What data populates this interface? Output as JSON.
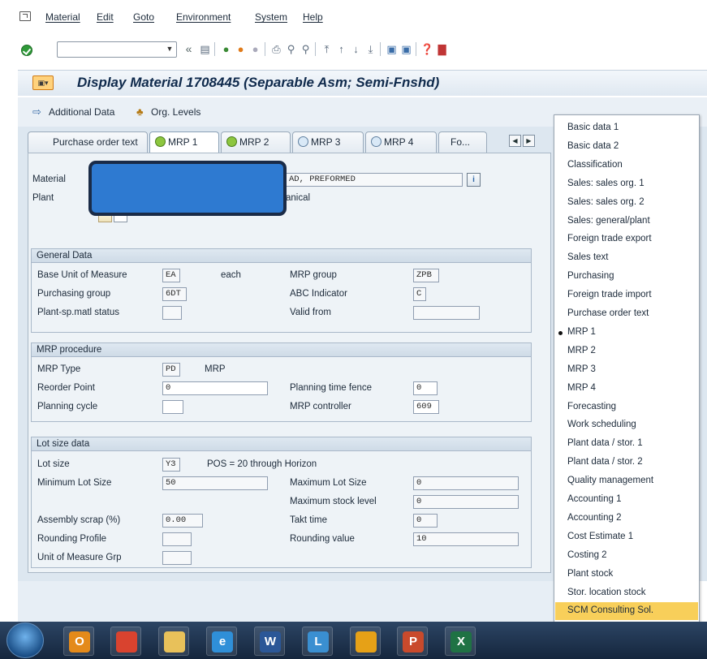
{
  "menu": [
    "Material",
    "Edit",
    "Goto",
    "Environment",
    "System",
    "Help"
  ],
  "toolbar": {
    "command_field_value": "",
    "back_glyph": "«"
  },
  "title": "Display Material 1708445 (Separable Asm; Semi-Fnshd)",
  "app_toolbar": {
    "additional_data": "Additional Data",
    "org_levels": "Org. Levels"
  },
  "tabs": [
    {
      "label": "Purchase order text",
      "icon": "none"
    },
    {
      "label": "MRP 1",
      "icon": "green-check",
      "active": true
    },
    {
      "label": "MRP 2",
      "icon": "green-check"
    },
    {
      "label": "MRP 3",
      "icon": "pending"
    },
    {
      "label": "MRP 4",
      "icon": "pending"
    },
    {
      "label": "Fo...",
      "icon": "none"
    }
  ],
  "header": {
    "material_label": "Material",
    "material_desc": "AD, PREFORMED",
    "plant_label": "Plant",
    "plant_desc": "anical"
  },
  "general_data": {
    "title": "General Data",
    "base_uom_label": "Base Unit of Measure",
    "base_uom": "EA",
    "base_uom_text": "each",
    "mrp_group_label": "MRP group",
    "mrp_group": "ZPB",
    "purch_group_label": "Purchasing group",
    "purch_group": "6DT",
    "abc_label": "ABC Indicator",
    "abc": "C",
    "plant_status_label": "Plant-sp.matl status",
    "plant_status": "",
    "valid_from_label": "Valid from",
    "valid_from": ""
  },
  "mrp_procedure": {
    "title": "MRP procedure",
    "mrp_type_label": "MRP Type",
    "mrp_type": "PD",
    "mrp_type_text": "MRP",
    "reorder_label": "Reorder Point",
    "reorder": "0",
    "ptf_label": "Planning time fence",
    "ptf": "0",
    "cycle_label": "Planning cycle",
    "cycle": "",
    "controller_label": "MRP controller",
    "controller": "609"
  },
  "lot_size": {
    "title": "Lot size data",
    "lot_size_label": "Lot size",
    "lot_size": "Y3",
    "lot_size_text": "POS = 20 through Horizon",
    "min_label": "Minimum Lot Size",
    "min": "50",
    "max_label": "Maximum Lot Size",
    "max": "0",
    "max_stock_label": "Maximum stock level",
    "max_stock": "0",
    "scrap_label": "Assembly scrap (%)",
    "scrap": "0.00",
    "takt_label": "Takt time",
    "takt": "0",
    "rounding_profile_label": "Rounding Profile",
    "rounding_profile": "",
    "rounding_value_label": "Rounding value",
    "rounding_value": "10",
    "uom_grp_label": "Unit of Measure Grp",
    "uom_grp": ""
  },
  "popup": {
    "items": [
      "Basic data 1",
      "Basic data 2",
      "Classification",
      "Sales: sales org. 1",
      "Sales: sales org. 2",
      "Sales: general/plant",
      "Foreign trade export",
      "Sales text",
      "Purchasing",
      "Foreign trade import",
      "Purchase order text",
      "MRP 1",
      "MRP 2",
      "MRP 3",
      "MRP 4",
      "Forecasting",
      "Work scheduling",
      "Plant data / stor. 1",
      "Plant data / stor. 2",
      "Quality management",
      "Accounting 1",
      "Accounting 2",
      "Cost Estimate 1",
      "Costing 2",
      "Plant stock",
      "Stor. location stock",
      "SCM Consulting Sol."
    ],
    "selected": "MRP 1",
    "highlighted": "SCM Consulting Sol."
  },
  "taskbar": {
    "apps": [
      {
        "name": "outlook",
        "glyph": "O",
        "color": "#e48a1a"
      },
      {
        "name": "chrome",
        "glyph": "",
        "color": "#d9432f"
      },
      {
        "name": "explorer",
        "glyph": "",
        "color": "#e8c15a"
      },
      {
        "name": "ie",
        "glyph": "e",
        "color": "#2f8fd8"
      },
      {
        "name": "word",
        "glyph": "W",
        "color": "#2b5797"
      },
      {
        "name": "lync",
        "glyph": "L",
        "color": "#3a8fd1"
      },
      {
        "name": "sap",
        "glyph": "",
        "color": "#e6a117"
      },
      {
        "name": "powerpoint",
        "glyph": "P",
        "color": "#c94a2c"
      },
      {
        "name": "excel",
        "glyph": "X",
        "color": "#1f7244"
      }
    ]
  }
}
